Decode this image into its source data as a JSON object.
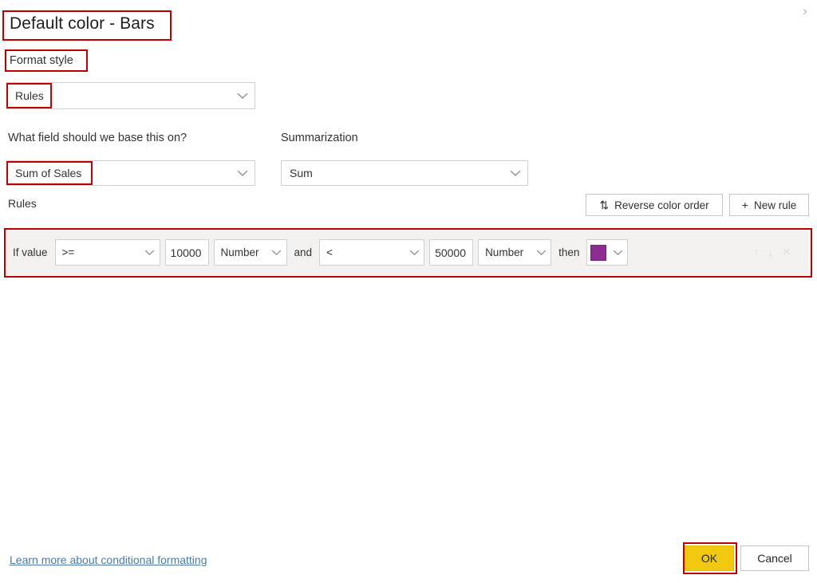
{
  "window": {
    "title": "Default color - Bars",
    "expand_chevron": "›"
  },
  "format_style": {
    "label": "Format style",
    "value": "Rules"
  },
  "base_field": {
    "label": "What field should we base this on?",
    "value": "Sum of Sales"
  },
  "summarization": {
    "label": "Summarization",
    "value": "Sum"
  },
  "rules_section": {
    "label": "Rules",
    "reverse_button": "Reverse color order",
    "reverse_icon": "⇅",
    "new_rule_button": "New rule",
    "new_rule_icon": "+"
  },
  "rule": {
    "if_value_label": "If value",
    "operator_min": ">=",
    "value_min": "10000",
    "unit_min": "Number",
    "and_label": "and",
    "operator_max": "<",
    "value_max": "50000",
    "unit_max": "Number",
    "then_label": "then",
    "color": "#8E2D91",
    "move_up_icon": "↑",
    "move_down_icon": "↓",
    "delete_icon": "✕"
  },
  "footer": {
    "learn_more_link": "Learn more about conditional formatting",
    "ok_button": "OK",
    "cancel_button": "Cancel"
  },
  "theme": {
    "annotation_color": "#C00000",
    "accent_yellow": "#F2C811",
    "rule_row_bg": "#F3F2F1",
    "link_color": "#4a7ba7"
  }
}
